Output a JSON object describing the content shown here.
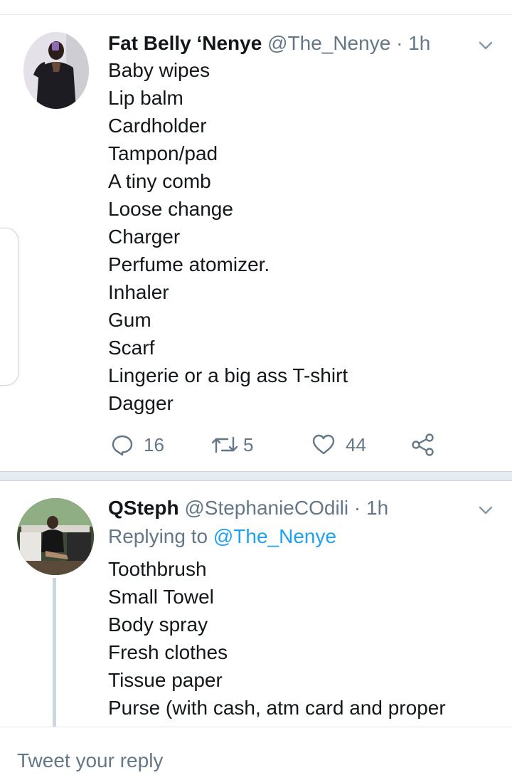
{
  "tweets": [
    {
      "name": "Fat Belly ‘Nenye",
      "handle": "@The_Nenye",
      "separator": "·",
      "time": "1h",
      "lines": [
        "Baby wipes",
        "Lip balm",
        "Cardholder",
        "Tampon/pad",
        "A tiny comb",
        "Loose change",
        "Charger",
        "Perfume atomizer.",
        "Inhaler",
        "Gum",
        "Scarf",
        "Lingerie or a big ass T-shirt",
        "Dagger"
      ],
      "actions": {
        "replies": "16",
        "retweets": "5",
        "likes": "44"
      },
      "icons": [
        "reply-icon",
        "retweet-icon",
        "like-icon",
        "share-icon",
        "chevron-down-icon"
      ]
    },
    {
      "name": "QSteph",
      "handle": "@StephanieCOdili",
      "separator": "·",
      "time": "1h",
      "replying_prefix": "Replying to ",
      "replying_to": "@The_Nenye",
      "lines": [
        "Toothbrush",
        "Small Towel",
        "Body spray",
        "Fresh clothes",
        "Tissue paper",
        "Purse (with cash, atm card and proper"
      ]
    }
  ],
  "composer": {
    "placeholder": "Tweet your reply"
  },
  "colors": {
    "text": "#14171a",
    "muted": "#657786",
    "link": "#1da1f2",
    "divider": "#e1e8ed",
    "section_bg": "#e6ecf0"
  }
}
